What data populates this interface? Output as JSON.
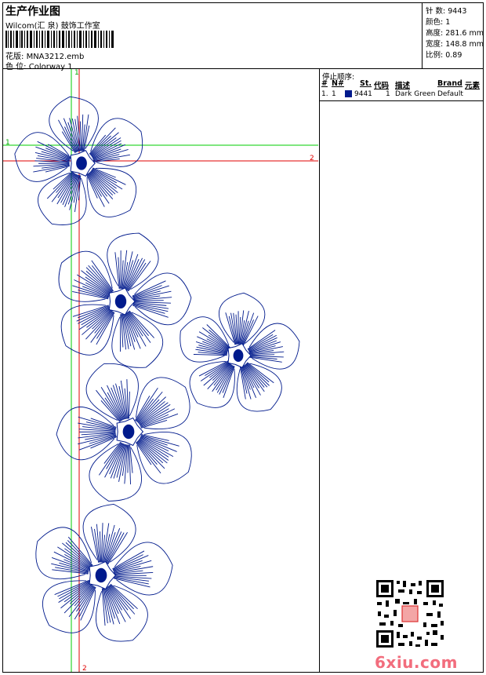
{
  "header": {
    "title": "生产作业图",
    "company": "Wilcom(汇 泉) 鼓饰工作室",
    "design_label": "花版:",
    "design_value": "MNA3212.emb",
    "colorway_label": "色 位:",
    "colorway_value": "Colorway 1"
  },
  "stats": [
    {
      "label": "针 数:",
      "value": "9443"
    },
    {
      "label": "颜色:",
      "value": "1"
    },
    {
      "label": "高度:",
      "value": "281.6 mm"
    },
    {
      "label": "宽度:",
      "value": "148.8 mm"
    },
    {
      "label": "比例:",
      "value": "0.89"
    }
  ],
  "stop_table": {
    "title": "停止顺序:",
    "columns": [
      "#",
      "N#",
      "St.",
      "代码",
      "描述",
      "Brand",
      "元素"
    ],
    "rows": [
      {
        "num": "1.",
        "n": "1",
        "code": "9441",
        "st": "1",
        "desc": "Dark Green",
        "brand": "Default",
        "swatch": "#001a8c"
      }
    ]
  },
  "guides": {
    "green_1": "1",
    "red_2": "2"
  },
  "watermark": "6xiu.com",
  "colors": {
    "thread": "#001a8c",
    "guide_green": "#00cc00",
    "guide_red": "#e00000"
  }
}
